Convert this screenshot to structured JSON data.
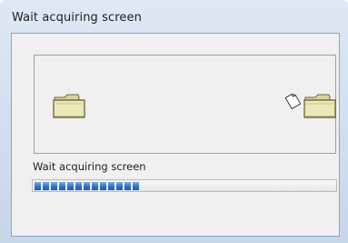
{
  "window": {
    "title": "Wait acquiring screen"
  },
  "animation": {
    "left_icon": "folder-icon",
    "right_icon": "folder-icon",
    "transfer_icon": "document-icon"
  },
  "status": {
    "text": "Wait acquiring screen"
  },
  "progress": {
    "value": 0.35,
    "fill_color": "#2a73c9"
  }
}
